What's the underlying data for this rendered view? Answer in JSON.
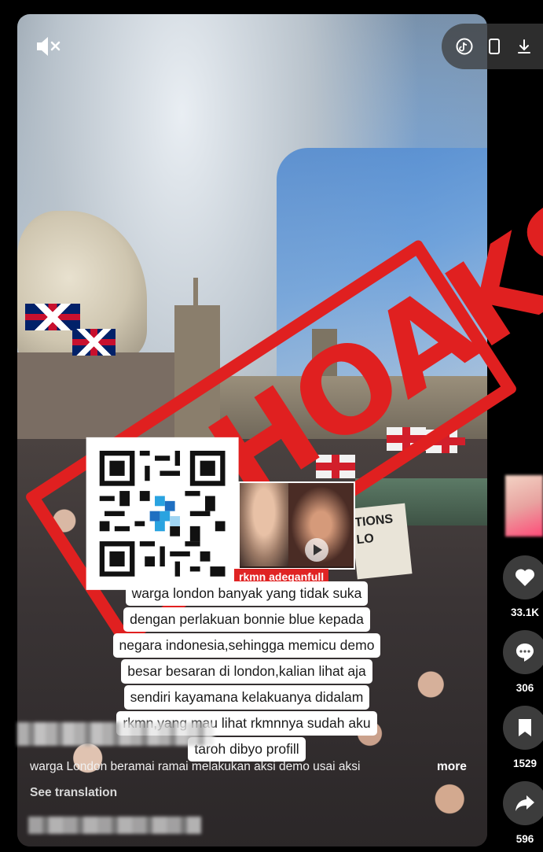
{
  "video": {
    "stamp_text": "HOAKS",
    "thumbnail_label": "rkmn adeganfull",
    "caption_lines": [
      "warga london banyak yang tidak suka",
      "dengan perlakuan bonnie blue kepada",
      "negara indonesia,sehingga memicu demo",
      "besar besaran di london,kalian lihat aja",
      "sendiri kayamana kelakuanya didalam",
      "rkmn,yang mau lihat rkmnnya sudah aku",
      "taroh dibyo profill"
    ],
    "sign_text": "TIONS LO"
  },
  "icons": {
    "mute": "speaker-muted-icon",
    "tiktok": "tiktok-logo-icon",
    "phone": "phone-icon",
    "download": "download-icon",
    "like": "heart-icon",
    "comment": "comment-icon",
    "save": "bookmark-icon",
    "share": "share-icon"
  },
  "post": {
    "description": "warga London beramai ramai melakukan aksi demo usai aksi",
    "more_label": "more",
    "translation_label": "See translation"
  },
  "actions": {
    "likes": "33.1K",
    "comments": "306",
    "saves": "1529",
    "shares": "596"
  },
  "colors": {
    "stamp_red": "#e02020",
    "background": "#000000"
  }
}
